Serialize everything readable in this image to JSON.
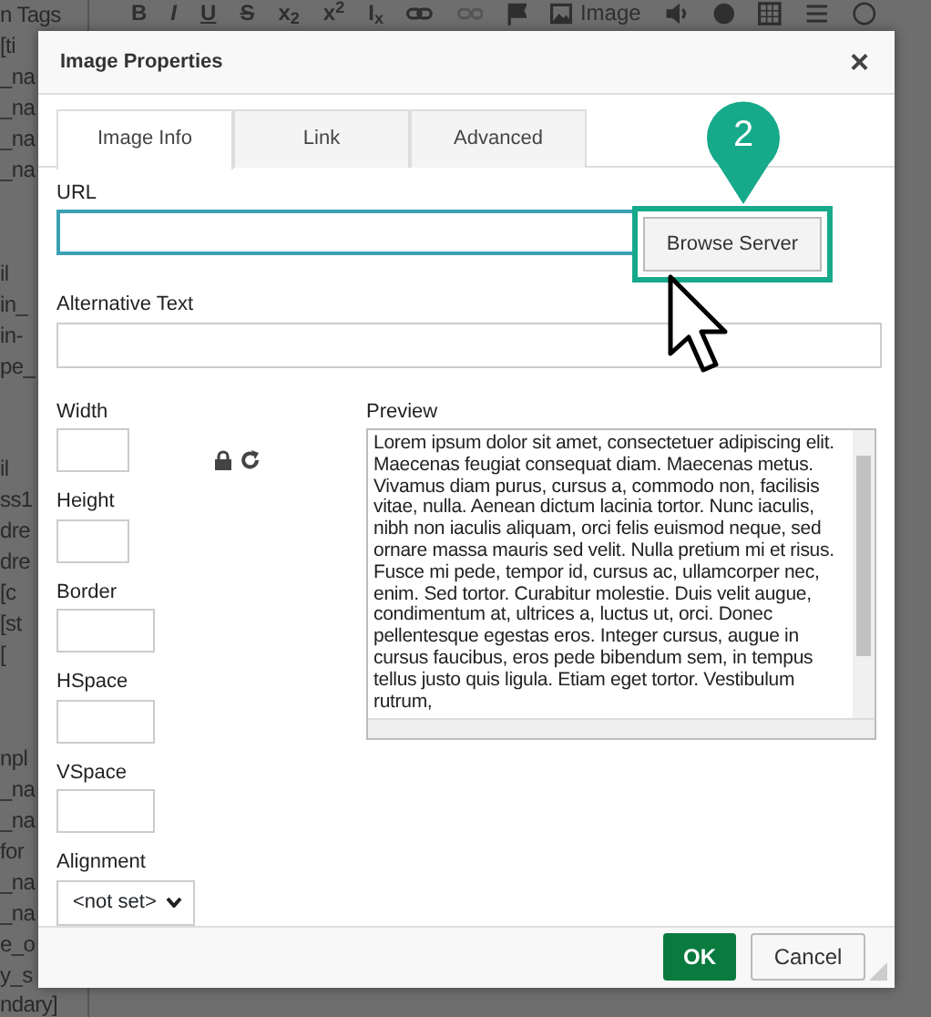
{
  "background": {
    "side_groups": [
      [
        "n Tags",
        "[ti",
        "_na",
        "_na",
        "_na",
        "_na"
      ],
      [
        "il",
        "in_",
        "in-",
        "pe_"
      ],
      [
        "il",
        "ss1",
        "dre",
        "dre",
        "[c",
        "[st",
        "["
      ],
      [
        "npl",
        "_na",
        "_na",
        "for",
        "_na",
        "_na",
        "e_o",
        "y_s",
        "ndary]"
      ]
    ],
    "toolbar_texts": [
      "B",
      "I",
      "U",
      "S",
      "x$_{2}$",
      "x$^{2}$",
      "I$_{x}$"
    ],
    "image_label": "Image"
  },
  "dialog": {
    "title": "Image Properties",
    "close": "×",
    "tabs": [
      {
        "label": "Image Info",
        "selected": true
      },
      {
        "label": "Link",
        "selected": false
      },
      {
        "label": "Advanced",
        "selected": false
      }
    ],
    "url": {
      "label": "URL",
      "focused": true
    },
    "browse_button": "Browse Server",
    "alt_text": {
      "label": "Alternative Text",
      "focused": false
    },
    "size_fields": [
      {
        "label": "Width",
        "kind": "short"
      },
      {
        "label": "Height",
        "kind": "short"
      },
      {
        "label": "Border",
        "kind": "long"
      },
      {
        "label": "HSpace",
        "kind": "long"
      },
      {
        "label": "VSpace",
        "kind": "long"
      }
    ],
    "alignment": {
      "label": "Alignment",
      "value": "<not set>"
    },
    "preview": {
      "label": "Preview",
      "text": "Lorem ipsum dolor sit amet, consectetuer adipiscing elit. Maecenas feugiat consequat diam. Maecenas metus. Vivamus diam purus, cursus a, commodo non, facilisis vitae, nulla. Aenean dictum lacinia tortor. Nunc iaculis, nibh non iaculis aliquam, orci felis euismod neque, sed ornare massa mauris sed velit. Nulla pretium mi et risus. Fusce mi pede, tempor id, cursus ac, ullamcorper nec, enim. Sed tortor. Curabitur molestie. Duis velit augue, condimentum at, ultrices a, luctus ut, orci. Donec pellentesque egestas eros. Integer cursus, augue in cursus faucibus, eros pede bibendum sem, in tempus tellus justo quis ligula. Etiam eget tortor. Vestibulum rutrum,"
    },
    "buttons": [
      {
        "label": "OK",
        "kind": "primary"
      },
      {
        "label": "Cancel",
        "kind": "secondary"
      }
    ]
  },
  "callout": {
    "number": "2"
  }
}
